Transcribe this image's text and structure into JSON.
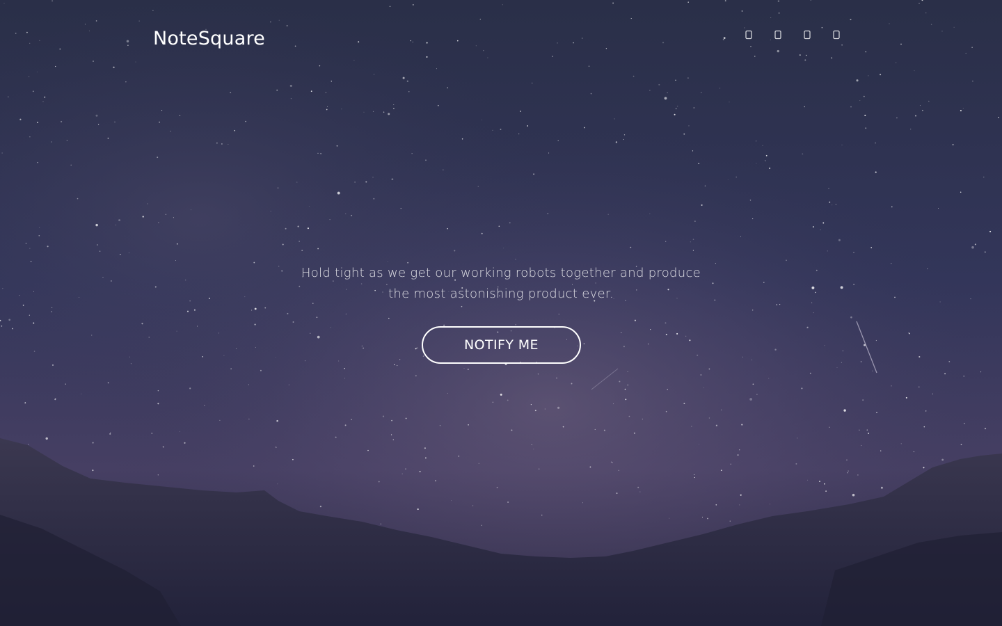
{
  "brand": {
    "name": "NoteSquare"
  },
  "social": [
    {
      "icon": "facebook-icon"
    },
    {
      "icon": "twitter-icon"
    },
    {
      "icon": "instagram-icon"
    },
    {
      "icon": "linkedin-icon"
    }
  ],
  "hero": {
    "tagline": "Hold tight as we get our working robots together and produce the most astonishing product ever.",
    "cta_label": "NOTIFY ME"
  },
  "colors": {
    "sky_top": "#2b3049",
    "sky_mid": "#39395a",
    "mountain": "#25253a",
    "text": "#ffffff"
  }
}
